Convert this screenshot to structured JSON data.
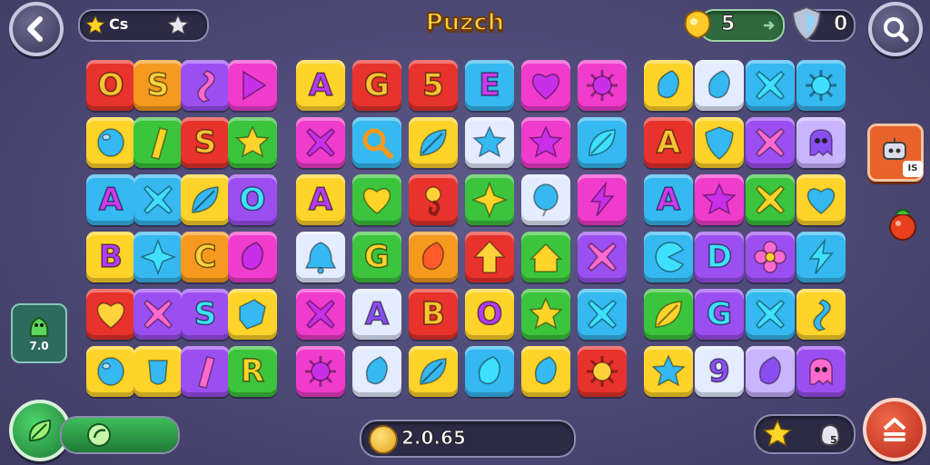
{
  "header": {
    "title": "Puzch",
    "star_badge_text": "Cs",
    "coins_value": "5",
    "gems_value": "0"
  },
  "side": {
    "right_badge": "IS",
    "left_card_label": "7.0"
  },
  "footer": {
    "coin_total": "2.0.65",
    "star_counter": "5."
  },
  "colors": {
    "red": "#e8322c",
    "orange": "#f59a1e",
    "yellow": "#ffd42a",
    "green": "#3cc43c",
    "blue": "#36b8f0",
    "purple": "#9c4ff0",
    "pink": "#f03ccc",
    "lilac": "#c9b4ff",
    "white": "#e4ecff"
  },
  "board": {
    "left": [
      [
        [
          "red",
          "O",
          "glyph"
        ],
        [
          "orange",
          "S",
          "glyph"
        ],
        [
          "purple",
          "swirl-icon",
          "icon"
        ],
        [
          "pink",
          "play-icon",
          "icon"
        ]
      ],
      [
        [
          "yellow",
          "orb-icon",
          "icon"
        ],
        [
          "green",
          "bar-icon",
          "icon"
        ],
        [
          "red",
          "S",
          "glyph"
        ],
        [
          "green",
          "star-icon",
          "icon"
        ]
      ],
      [
        [
          "blue",
          "A",
          "glyph"
        ],
        [
          "blue",
          "x-icon",
          "icon"
        ],
        [
          "yellow",
          "leaf-icon",
          "icon"
        ],
        [
          "purple",
          "O",
          "glyph"
        ]
      ],
      [
        [
          "yellow",
          "B",
          "glyph"
        ],
        [
          "blue",
          "star4-icon",
          "icon"
        ],
        [
          "orange",
          "C",
          "glyph"
        ],
        [
          "pink",
          "gem-icon",
          "icon"
        ]
      ],
      [
        [
          "red",
          "heart-icon",
          "icon"
        ],
        [
          "purple",
          "x-icon",
          "icon"
        ],
        [
          "purple",
          "S",
          "glyph"
        ],
        [
          "yellow",
          "cube-icon",
          "icon"
        ]
      ],
      [
        [
          "yellow",
          "orb-icon",
          "icon"
        ],
        [
          "yellow",
          "cup-icon",
          "icon"
        ],
        [
          "purple",
          "bar-icon",
          "icon"
        ],
        [
          "green",
          "R",
          "glyph"
        ]
      ]
    ],
    "middle": [
      [
        [
          "yellow",
          "A",
          "glyph"
        ],
        [
          "red",
          "G",
          "glyph"
        ],
        [
          "red",
          "5",
          "glyph"
        ],
        [
          "blue",
          "E",
          "glyph"
        ],
        [
          "pink",
          "heart-icon",
          "icon"
        ],
        [
          "pink",
          "sun-icon",
          "icon"
        ]
      ],
      [
        [
          "pink",
          "x-icon",
          "icon"
        ],
        [
          "blue",
          "search-icon",
          "icon"
        ],
        [
          "yellow",
          "leaf-icon",
          "icon"
        ],
        [
          "white",
          "star-icon",
          "icon"
        ],
        [
          "pink",
          "star-icon",
          "icon"
        ],
        [
          "blue",
          "leaf-icon",
          "icon"
        ]
      ],
      [
        [
          "yellow",
          "A",
          "glyph"
        ],
        [
          "green",
          "heart-icon",
          "icon"
        ],
        [
          "red",
          "clef-icon",
          "icon"
        ],
        [
          "green",
          "star4-icon",
          "icon"
        ],
        [
          "white",
          "balloon-icon",
          "icon"
        ],
        [
          "pink",
          "bolt-icon",
          "icon"
        ]
      ],
      [
        [
          "white",
          "bell-icon",
          "icon"
        ],
        [
          "green",
          "G",
          "glyph"
        ],
        [
          "orange",
          "gem-icon",
          "icon"
        ],
        [
          "red",
          "arrow-up-icon",
          "icon"
        ],
        [
          "green",
          "house-icon",
          "icon"
        ],
        [
          "purple",
          "x-icon",
          "icon"
        ]
      ],
      [
        [
          "pink",
          "x-icon",
          "icon"
        ],
        [
          "white",
          "A",
          "glyph"
        ],
        [
          "red",
          "B",
          "glyph"
        ],
        [
          "yellow",
          "O",
          "glyph"
        ],
        [
          "green",
          "star-icon",
          "icon"
        ],
        [
          "blue",
          "x-icon",
          "icon"
        ]
      ],
      [
        [
          "pink",
          "sun-icon",
          "icon"
        ],
        [
          "white",
          "gem-icon",
          "icon"
        ],
        [
          "yellow",
          "leaf-icon",
          "icon"
        ],
        [
          "blue",
          "gem-icon",
          "icon"
        ],
        [
          "yellow",
          "gem-icon",
          "icon"
        ],
        [
          "red",
          "sun-icon",
          "icon"
        ]
      ]
    ],
    "right": [
      [
        [
          "yellow",
          "gem-icon",
          "icon"
        ],
        [
          "white",
          "gem-icon",
          "icon"
        ],
        [
          "blue",
          "x-icon",
          "icon"
        ],
        [
          "blue",
          "sun-icon",
          "icon"
        ]
      ],
      [
        [
          "red",
          "A",
          "glyph"
        ],
        [
          "yellow",
          "shield-icon",
          "icon"
        ],
        [
          "purple",
          "x-icon",
          "icon"
        ],
        [
          "lilac",
          "ghost-icon",
          "icon"
        ]
      ],
      [
        [
          "blue",
          "A",
          "glyph"
        ],
        [
          "pink",
          "star-icon",
          "icon"
        ],
        [
          "green",
          "x-icon",
          "icon"
        ],
        [
          "yellow",
          "heart-icon",
          "icon"
        ]
      ],
      [
        [
          "blue",
          "pacman-icon",
          "icon"
        ],
        [
          "purple",
          "D",
          "glyph"
        ],
        [
          "purple",
          "flower-icon",
          "icon"
        ],
        [
          "blue",
          "bolt-icon",
          "icon"
        ]
      ],
      [
        [
          "green",
          "leaf-icon",
          "icon"
        ],
        [
          "purple",
          "G",
          "glyph"
        ],
        [
          "blue",
          "x-icon",
          "icon"
        ],
        [
          "yellow",
          "swirl-icon",
          "icon"
        ]
      ],
      [
        [
          "yellow",
          "star-icon",
          "icon"
        ],
        [
          "white",
          "9",
          "glyph"
        ],
        [
          "lilac",
          "gem-icon",
          "icon"
        ],
        [
          "purple",
          "ghost-icon",
          "icon"
        ]
      ]
    ]
  }
}
